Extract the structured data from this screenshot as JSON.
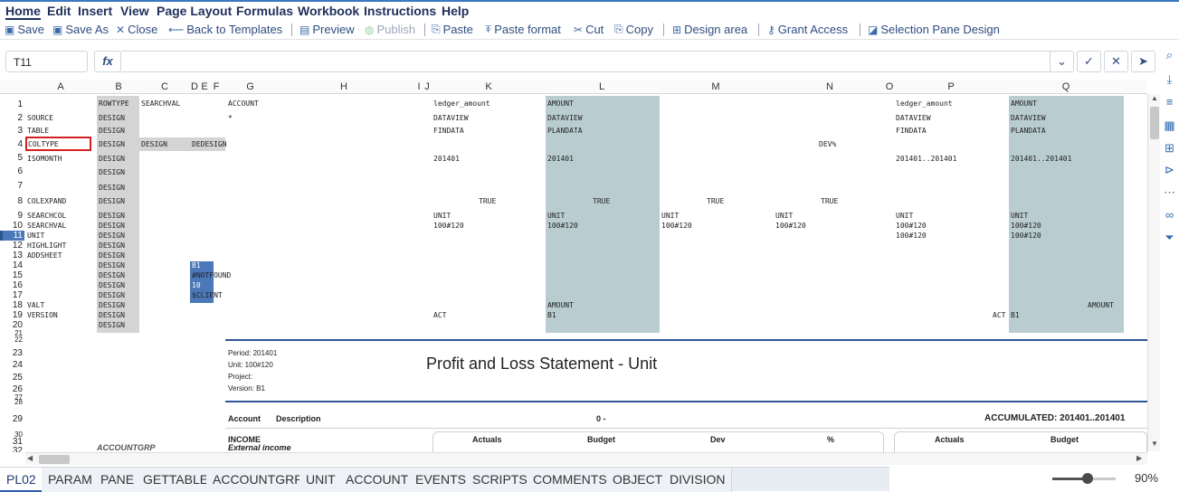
{
  "menu": [
    "Home",
    "Edit",
    "Insert",
    "View",
    "Page Layout",
    "Formulas",
    "Workbook",
    "Instructions",
    "Help"
  ],
  "toolbar": {
    "save": "Save",
    "save_as": "Save As",
    "close": "Close",
    "back": "Back to Templates",
    "preview": "Preview",
    "publish": "Publish",
    "paste": "Paste",
    "paste_format": "Paste format",
    "cut": "Cut",
    "copy": "Copy",
    "design_area": "Design area",
    "grant_access": "Grant Access",
    "selection_pane": "Selection Pane Design"
  },
  "formula_bar": {
    "cell_ref": "T11",
    "fx": "fx",
    "formula": ""
  },
  "columns": [
    "A",
    "B",
    "C",
    "D",
    "E",
    "F",
    "G",
    "H",
    "I",
    "J",
    "K",
    "L",
    "M",
    "N",
    "O",
    "P",
    "Q"
  ],
  "rows": [
    "1",
    "2",
    "3",
    "4",
    "5",
    "6",
    "7",
    "8",
    "9",
    "10",
    "11",
    "12",
    "13",
    "14",
    "15",
    "16",
    "17",
    "18",
    "19",
    "20",
    "21",
    "22",
    "23",
    "24",
    "25",
    "26",
    "27",
    "28",
    "29",
    "30",
    "31",
    "32"
  ],
  "cells": {
    "a2": "SOURCE",
    "a3": "TABLE",
    "a4": "COLTYPE",
    "a5": "ISOMONTH",
    "a8": "COLEXPAND",
    "a9": "SEARCHCOL",
    "a10": "SEARCHVAL",
    "a11": "UNIT",
    "a12": "HIGHLIGHT",
    "a13": "ADDSHEET",
    "a18": "VALT",
    "a19": "VERSION",
    "b1": "ROWTYPE",
    "design": "DESIGN",
    "c1": "SEARCHVAL",
    "c4": "DESIGN",
    "d4": "DEDESIGN",
    "d14": "B1",
    "d15": "#NOTFOUND",
    "d16": "10",
    "d17": "$CLIENT",
    "g1": "ACCOUNT",
    "g2": "*",
    "k1": "ledger_amount",
    "k2": "DATAVIEW",
    "k3": "FINDATA",
    "k5": "201401",
    "k8": "TRUE",
    "k9": "UNIT",
    "k10": "100#120",
    "k19": "ACT",
    "l1": "AMOUNT",
    "l2": "DATAVIEW",
    "l3": "PLANDATA",
    "l5": "201401",
    "l8": "TRUE",
    "l9": "UNIT",
    "l10": "100#120",
    "l18": "AMOUNT",
    "l19": "B1",
    "m8": "TRUE",
    "m9": "UNIT",
    "m10": "100#120",
    "n4": "DEV%",
    "n8": "TRUE",
    "n9": "UNIT",
    "n10": "100#120",
    "p1": "ledger_amount",
    "p2": "DATAVIEW",
    "p3": "FINDATA",
    "p5": "201401..201401",
    "p9": "UNIT",
    "p10": "100#120",
    "p11": "100#120",
    "p19": "ACT",
    "q1": "AMOUNT",
    "q2": "DATAVIEW",
    "q3": "PLANDATA",
    "q5": "201401..201401",
    "q9": "UNIT",
    "q10": "100#120",
    "q11": "100#120",
    "q18": "AMOUNT",
    "q19": "B1"
  },
  "report": {
    "period": "Period: 201401",
    "unit": "Unit: 100#120",
    "project": "Project:",
    "version": "Version: B1",
    "title": "Profit and Loss Statement - Unit",
    "account": "Account",
    "description": "Description",
    "period_col": "0 -",
    "accumulated": "ACCUMULATED: 201401..201401",
    "income": "INCOME",
    "external_income": "External income",
    "accountgrp": "ACCOUNTGRP",
    "actuals": "Actuals",
    "budget": "Budget",
    "dev": "Dev",
    "pct": "%"
  },
  "sheet_tabs": [
    "PL02",
    "PARAM",
    "PANE",
    "GETTABLE",
    "ACCOUNTGRP",
    "UNIT",
    "ACCOUNT",
    "EVENTS",
    "SCRIPTS",
    "COMMENTS",
    "OBJECT",
    "DIVISION"
  ],
  "zoom": "90%",
  "colors": {
    "accent": "#2a5aa8",
    "design_gray": "#d4d4d4",
    "teal": "#b9cdd0",
    "blue_cell": "#4a78b8"
  }
}
